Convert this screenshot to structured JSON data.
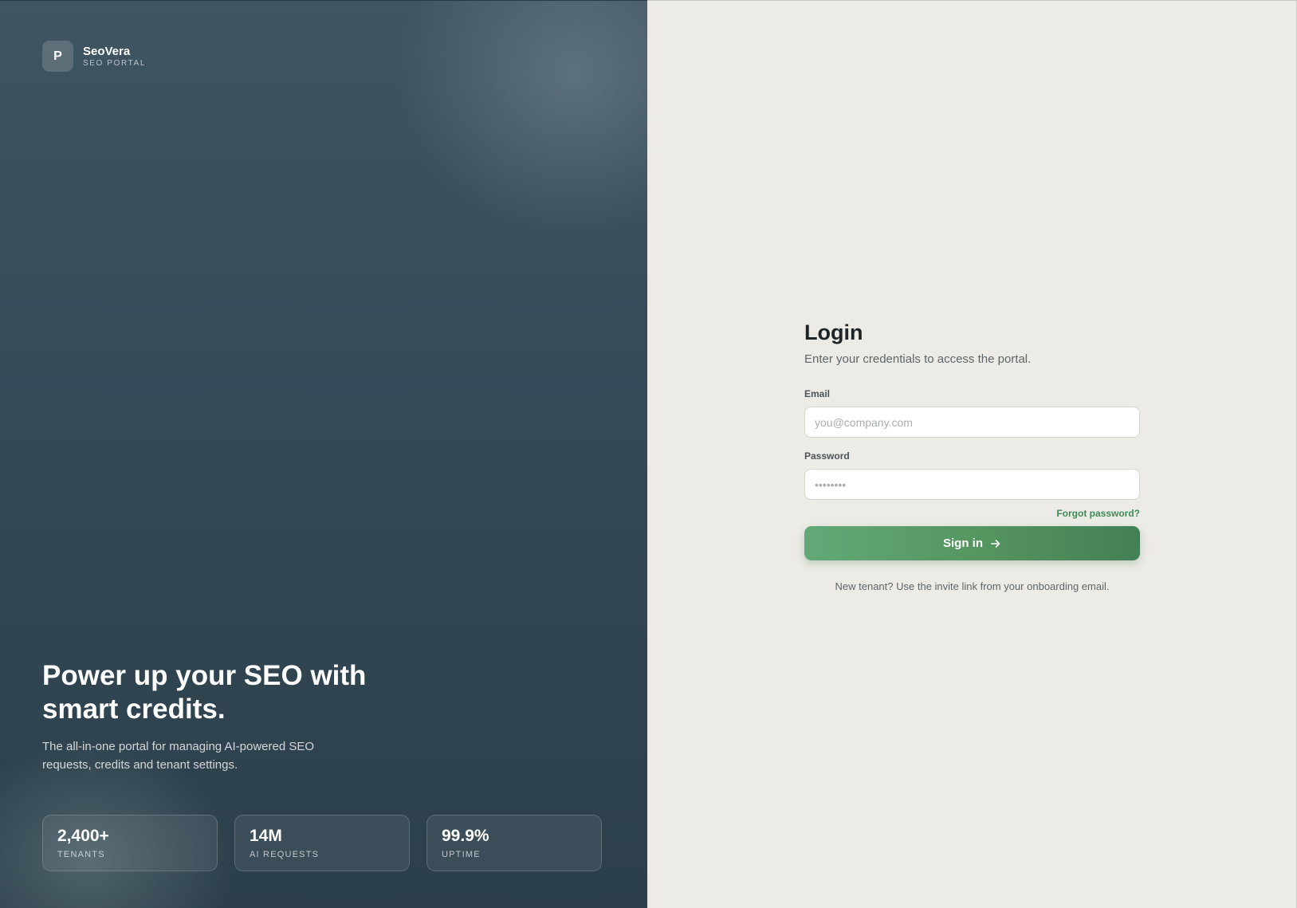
{
  "brand": {
    "mark": "P",
    "name": "SeoVera",
    "tagline": "SEO PORTAL"
  },
  "hero": {
    "headline": "Power up your SEO with smart credits.",
    "subline": "The all-in-one portal for managing AI-powered SEO requests, credits and tenant settings.",
    "stats": [
      {
        "value": "2,400+",
        "label": "TENANTS"
      },
      {
        "value": "14M",
        "label": "AI REQUESTS"
      },
      {
        "value": "99.9%",
        "label": "UPTIME"
      }
    ]
  },
  "login": {
    "title": "Login",
    "subtitle": "Enter your credentials to access the portal.",
    "email": {
      "label": "Email",
      "value": "",
      "placeholder": "you@company.com"
    },
    "password": {
      "label": "Password",
      "value": "",
      "placeholder": "••••••••"
    },
    "forgot_label": "Forgot password?",
    "submit_label": "Sign in",
    "submit_icon": "arrow-right-icon",
    "footnote": "New tenant? Use the invite link from your onboarding email."
  },
  "colors": {
    "hero_bg": "#354b58",
    "panel_bg": "#ecebe5",
    "accent": "#54945f",
    "link": "#3f8a57"
  }
}
